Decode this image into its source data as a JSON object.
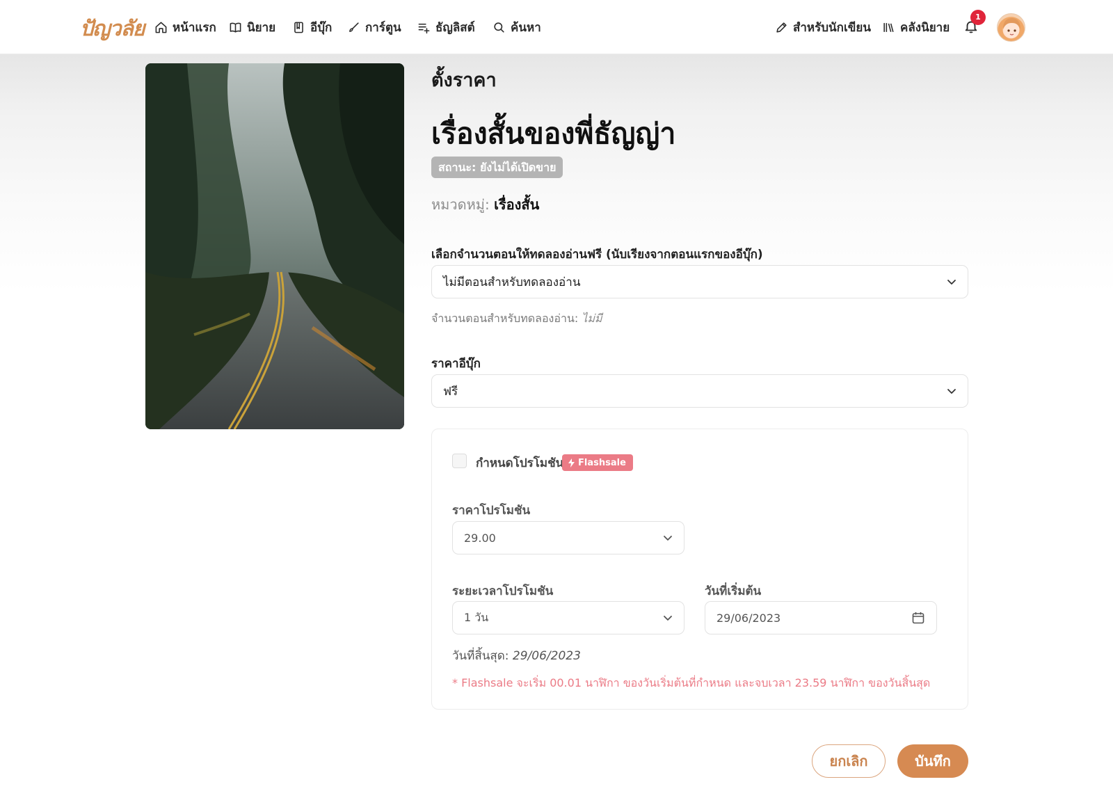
{
  "nav": {
    "logo": "ปัญวลัย",
    "items": [
      {
        "label": "หน้าแรก",
        "icon": "home-icon"
      },
      {
        "label": "นิยาย",
        "icon": "book-open-icon"
      },
      {
        "label": "อีบุ๊ก",
        "icon": "ebook-icon"
      },
      {
        "label": "การ์ตูน",
        "icon": "brush-icon"
      },
      {
        "label": "ธัญลิสต์",
        "icon": "list-add-icon"
      },
      {
        "label": "ค้นหา",
        "icon": "search-icon"
      }
    ],
    "writer_label": "สำหรับนักเขียน",
    "library_label": "คลังนิยาย",
    "notification_count": "1"
  },
  "page": {
    "section_label": "ตั้งราคา",
    "book_title": "เรื่องสั้นของพี่ธัญญ่า",
    "status": "สถานะ: ยังไม่ได้เปิดขาย",
    "category_key": "หมวดหมู่:",
    "category_value": "เรื่องสั้น"
  },
  "trial": {
    "label": "เลือกจำนวนตอนให้ทดลองอ่านฟรี (นับเรียงจากตอนแรกของอีบุ๊ก)",
    "selected": "ไม่มีตอนสำหรับทดลองอ่าน",
    "helper_key": "จำนวนตอนสำหรับทดลองอ่าน:",
    "helper_value": "ไม่มี"
  },
  "price": {
    "label": "ราคาอีบุ๊ก",
    "selected": "ฟรี"
  },
  "promotion": {
    "checkbox_label": "กำหนดโปรโมชัน",
    "flash_badge": "Flashsale",
    "price_label": "ราคาโปรโมชัน",
    "price_value": "29.00",
    "duration_label": "ระยะเวลาโปรโมชัน",
    "duration_value": "1 วัน",
    "start_label": "วันที่เริ่มต้น",
    "start_value": "29/06/2023",
    "end_key": "วันที่สิ้นสุด:",
    "end_value": "29/06/2023",
    "note": "* Flashsale จะเริ่ม 00.01 นาฬิกา ของวันเริ่มต้นที่กำหนด และจบเวลา 23.59 นาฬิกา ของวันสิ้นสุด"
  },
  "actions": {
    "cancel_label": "ยกเลิก",
    "save_label": "บันทึก"
  },
  "colors": {
    "accent": "#d68a52",
    "flash": "#eb7b86",
    "badge": "#e0253a",
    "status_chip": "#b4b4b4"
  }
}
